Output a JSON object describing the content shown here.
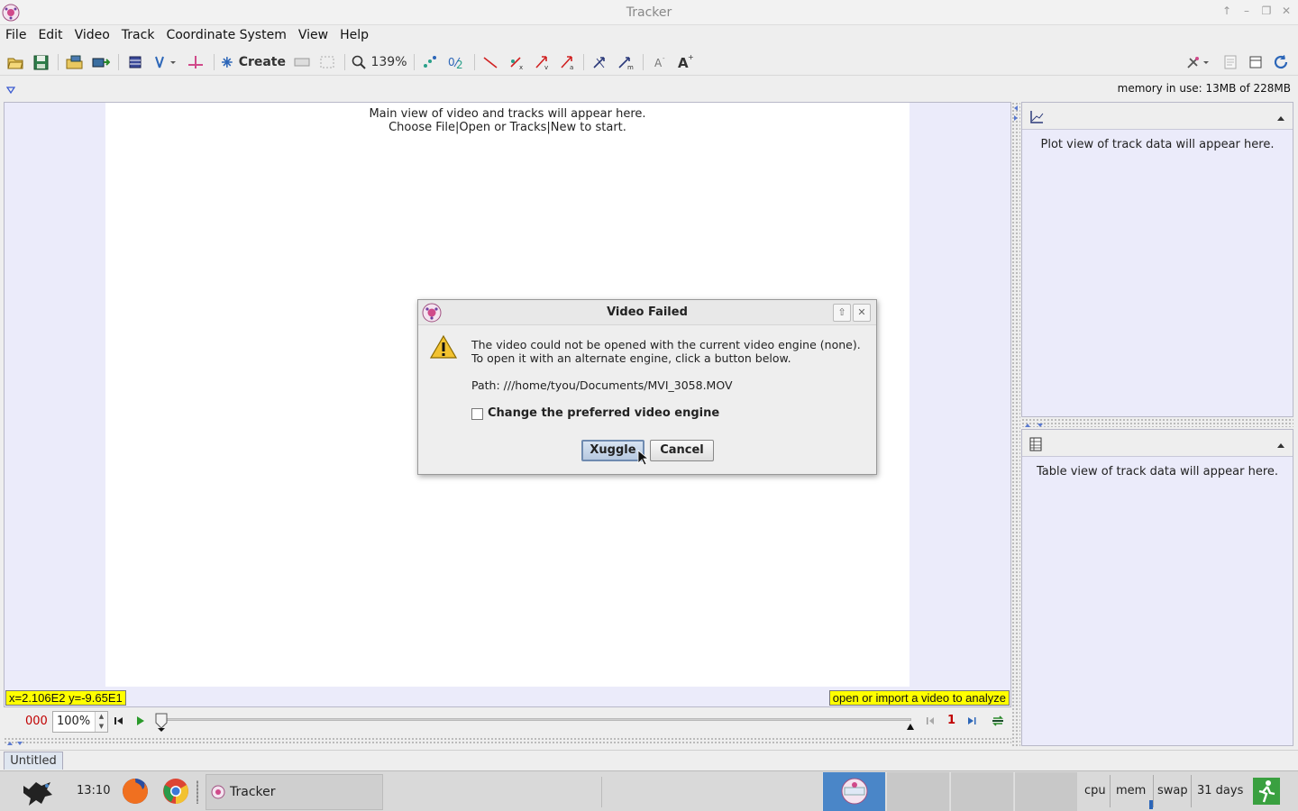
{
  "window": {
    "title": "Tracker"
  },
  "menu": [
    "File",
    "Edit",
    "Video",
    "Track",
    "Coordinate System",
    "View",
    "Help"
  ],
  "toolbar": {
    "create_label": "Create",
    "zoom_label": "139%"
  },
  "memory": "memory in use: 13MB of 228MB",
  "main_view": {
    "line1": "Main view of video and tracks will appear here.",
    "line2": "Choose File|Open or Tracks|New to start.",
    "coords": "x=2.106E2  y=-9.65E1",
    "hint": "open or import a video to analyze"
  },
  "player": {
    "frame": "000",
    "rate": "100%",
    "step": "1"
  },
  "plot_panel": {
    "message": "Plot view of track data will appear here."
  },
  "table_panel": {
    "message": "Table view of track data will appear here."
  },
  "tab": {
    "label": "Untitled"
  },
  "dialog": {
    "title": "Video Failed",
    "line1": "The video could not be opened with the current video engine (none).",
    "line2": "To open it with an alternate engine, click a button below.",
    "path": "Path: ///home/tyou/Documents/MVI_3058.MOV",
    "checkbox_label": "Change the preferred video engine",
    "checkbox_checked": false,
    "primary_button": "Xuggle",
    "cancel_button": "Cancel"
  },
  "taskbar": {
    "clock": "13:10",
    "task_label": "Tracker",
    "tray": {
      "cpu": "cpu",
      "mem": "mem",
      "swap": "swap",
      "uptime": "31 days"
    }
  },
  "colors": {
    "accent": "#2c66b8",
    "highlight": "#ffff00",
    "frame_red": "#c00000"
  }
}
